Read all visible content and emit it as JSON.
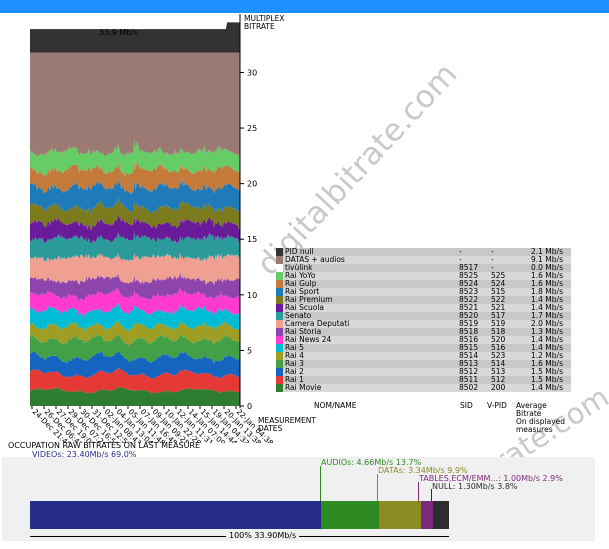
{
  "header": {
    "peak_label": "33.9 Mb/s",
    "chart_title_line1": "MULTIPLEX",
    "chart_title_line2": "BITRATE",
    "watermark": "digitalbitrate.com"
  },
  "chart_data": {
    "type": "area",
    "title": "MULTIPLEX BITRATE",
    "ylabel": "",
    "xlabel": "MEASUREMENT DATES",
    "ylim": [
      0,
      34
    ],
    "y_ticks": [
      0,
      5,
      10,
      15,
      20,
      25,
      30
    ],
    "x_ticks": [
      "24-Dec 21:45",
      "26-Dec 06:42",
      "27-Dec 19:07",
      "29-Dec 07:26",
      "30-Dec 16:50",
      "31-Dec 12:57",
      "02-Jan 08:43",
      "04-Jan 13:04",
      "05-Jan 11:48",
      "07-Jan 16:45",
      "09-Jan 09:25",
      "10-Jan 22:29",
      "12-Jan 11:31",
      "14-Jan 07:09",
      "15-Jan 14:44",
      "19-Jan 04:32",
      "20-Jan 13:38",
      "22-Jan 04:38"
    ],
    "series": [
      {
        "name": "Rai Movie",
        "color": "#2e7d32",
        "values": [
          1.4,
          1.4
        ]
      },
      {
        "name": "Rai 1",
        "color": "#e53935",
        "values": [
          1.5,
          1.5
        ]
      },
      {
        "name": "Rai 2",
        "color": "#1565c0",
        "values": [
          1.5,
          1.5
        ]
      },
      {
        "name": "Rai 3",
        "color": "#43a047",
        "values": [
          1.6,
          1.6
        ]
      },
      {
        "name": "Rai 4",
        "color": "#9e9d24",
        "values": [
          1.2,
          1.2
        ]
      },
      {
        "name": "Rai 5",
        "color": "#00bcd4",
        "values": [
          1.4,
          1.4
        ]
      },
      {
        "name": "Rai News 24",
        "color": "#ff3ad0",
        "values": [
          1.4,
          1.4
        ]
      },
      {
        "name": "Rai Storia",
        "color": "#8e44ad",
        "values": [
          1.4,
          1.4
        ]
      },
      {
        "name": "Camera Deputati",
        "color": "#f0a090",
        "values": [
          2.0,
          2.0
        ]
      },
      {
        "name": "Senato",
        "color": "#2a9a9a",
        "values": [
          1.7,
          1.7
        ]
      },
      {
        "name": "Rai Scuola",
        "color": "#6a1b9a",
        "values": [
          1.4,
          1.4
        ]
      },
      {
        "name": "Rai Premium",
        "color": "#7b7a1c",
        "values": [
          1.4,
          1.4
        ]
      },
      {
        "name": "Rai Sport",
        "color": "#1e7ab8",
        "values": [
          1.8,
          1.8
        ]
      },
      {
        "name": "Rai Gulp",
        "color": "#c47a3a",
        "values": [
          1.6,
          1.6
        ]
      },
      {
        "name": "Rai YoYo",
        "color": "#66cc66",
        "values": [
          1.6,
          1.6
        ]
      },
      {
        "name": "tivùlink",
        "color": "#ffffff",
        "values": [
          0.0,
          0.0
        ]
      },
      {
        "name": "DATAS + audios",
        "color": "#9c7a74",
        "values": [
          9.1,
          9.1
        ]
      },
      {
        "name": "PID null",
        "color": "#333333",
        "values": [
          2.1,
          2.1
        ]
      }
    ]
  },
  "legend": {
    "rows": [
      {
        "name": "PID null",
        "sid": "-",
        "vpid": "-",
        "bitrate": "2.1 Mb/s",
        "color": "#333333"
      },
      {
        "name": "DATAS + audios",
        "sid": "-",
        "vpid": "-",
        "bitrate": "9.1 Mb/s",
        "color": "#9c7a74"
      },
      {
        "name": "tivùlink",
        "sid": "8517",
        "vpid": "-",
        "bitrate": "0.0 Mb/s",
        "color": "#ffffff"
      },
      {
        "name": "Rai YoYo",
        "sid": "8525",
        "vpid": "525",
        "bitrate": "1.6 Mb/s",
        "color": "#66cc66"
      },
      {
        "name": "Rai Gulp",
        "sid": "8524",
        "vpid": "524",
        "bitrate": "1.6 Mb/s",
        "color": "#c47a3a"
      },
      {
        "name": "Rai Sport",
        "sid": "8523",
        "vpid": "515",
        "bitrate": "1.8 Mb/s",
        "color": "#1e7ab8"
      },
      {
        "name": "Rai Premium",
        "sid": "8522",
        "vpid": "522",
        "bitrate": "1.4 Mb/s",
        "color": "#7b7a1c"
      },
      {
        "name": "Rai Scuola",
        "sid": "8521",
        "vpid": "521",
        "bitrate": "1.4 Mb/s",
        "color": "#6a1b9a"
      },
      {
        "name": "Senato",
        "sid": "8520",
        "vpid": "517",
        "bitrate": "1.7 Mb/s",
        "color": "#2a9a9a"
      },
      {
        "name": "Camera Deputati",
        "sid": "8519",
        "vpid": "519",
        "bitrate": "2.0 Mb/s",
        "color": "#f0a090"
      },
      {
        "name": "Rai Storia",
        "sid": "8518",
        "vpid": "518",
        "bitrate": "1.3 Mb/s",
        "color": "#8e44ad"
      },
      {
        "name": "Rai News 24",
        "sid": "8516",
        "vpid": "520",
        "bitrate": "1.4 Mb/s",
        "color": "#ff3ad0"
      },
      {
        "name": "Rai 5",
        "sid": "8515",
        "vpid": "516",
        "bitrate": "1.4 Mb/s",
        "color": "#00bcd4"
      },
      {
        "name": "Rai 4",
        "sid": "8514",
        "vpid": "523",
        "bitrate": "1.2 Mb/s",
        "color": "#9e9d24"
      },
      {
        "name": "Rai 3",
        "sid": "8513",
        "vpid": "514",
        "bitrate": "1.6 Mb/s",
        "color": "#43a047"
      },
      {
        "name": "Rai 2",
        "sid": "8512",
        "vpid": "513",
        "bitrate": "1.5 Mb/s",
        "color": "#1565c0"
      },
      {
        "name": "Rai 1",
        "sid": "8511",
        "vpid": "512",
        "bitrate": "1.5 Mb/s",
        "color": "#e53935"
      },
      {
        "name": "Rai Movie",
        "sid": "8502",
        "vpid": "200",
        "bitrate": "1.4 Mb/s",
        "color": "#2e7d32"
      }
    ],
    "col_name": "NOM/NAME",
    "col_sid": "SID",
    "col_vpid": "V-PID",
    "col_bitrate_1": "Average",
    "col_bitrate_2": "Bitrate",
    "col_bitrate_3": "On displayed",
    "col_bitrate_4": "measures",
    "measurement_1": "MEASUREMENT",
    "measurement_2": "DATES"
  },
  "occupation": {
    "title": "OCCUPATION RAW BITRATES ON LAST MEASURE",
    "video": "VIDEOs: 23.40Mb/s  69.0%",
    "audio": "AUDIOs: 4.66Mb/s  13.7%",
    "datas": "DATAs: 3.34Mb/s  9.9%",
    "tables": "TABLES,ECM/EMM...: 1.00Mb/s  2.9%",
    "null": "NULL: 1.30Mb/s  3.8%",
    "total": "100%  33.90Mb/s",
    "segments": [
      {
        "key": "video",
        "fraction": 0.69,
        "color": "#262c8a"
      },
      {
        "key": "audio",
        "fraction": 0.137,
        "color": "#2e8b22"
      },
      {
        "key": "datas",
        "fraction": 0.099,
        "color": "#8c8a22"
      },
      {
        "key": "tables",
        "fraction": 0.029,
        "color": "#7a2a7a"
      },
      {
        "key": "null",
        "fraction": 0.038,
        "color": "#2d2d2d"
      }
    ]
  }
}
